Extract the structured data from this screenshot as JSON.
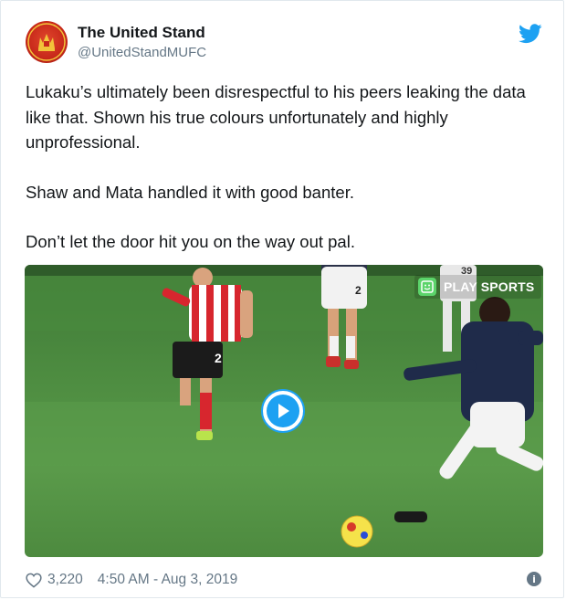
{
  "tweet": {
    "display_name": "The United Stand",
    "handle": "@UnitedStandMUFC",
    "paragraphs": [
      "Lukaku’s ultimately been disrespectful to his peers leaking the data like that. Shown his true colours unfortunately and highly unprofessional.",
      "Shaw and Mata handled it with good banter.",
      "Don’t let the door hit you on the way out pal."
    ],
    "media": {
      "badge_label": "PLAY SPORTS",
      "shirt_numbers": [
        "2",
        "2",
        "39"
      ]
    },
    "likes": "3,220",
    "timestamp": "4:50 AM - Aug 3, 2019"
  },
  "icons": {
    "avatar": "club-crest-icon",
    "twitter": "twitter-bird-icon",
    "play": "play-icon",
    "like": "heart-icon",
    "info": "info-icon",
    "badge": "smiley-icon"
  },
  "colors": {
    "twitter_blue": "#1da1f2",
    "text": "#14171a",
    "secondary_text": "#657786",
    "avatar_red": "#c7281a",
    "pitch_green": "#4e8d41",
    "badge_green": "#5bd46a"
  }
}
